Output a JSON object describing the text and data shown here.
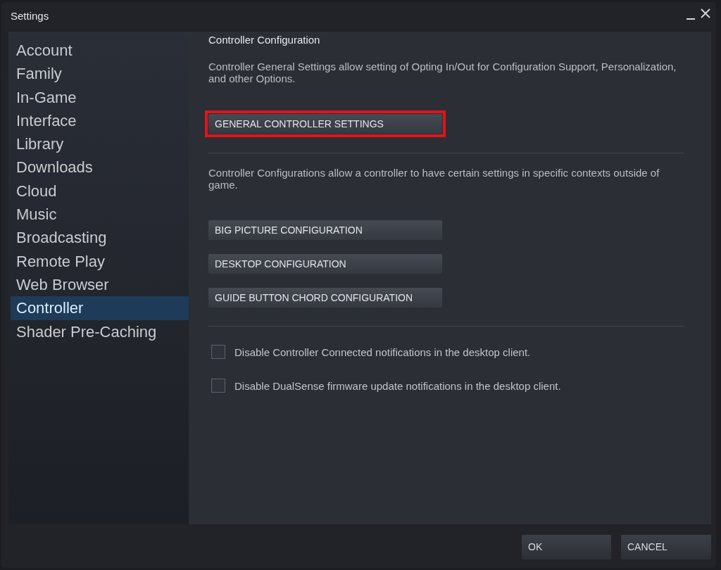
{
  "window": {
    "title": "Settings"
  },
  "sidebar": {
    "items": [
      {
        "label": "Account",
        "selected": false
      },
      {
        "label": "Family",
        "selected": false
      },
      {
        "label": "In-Game",
        "selected": false
      },
      {
        "label": "Interface",
        "selected": false
      },
      {
        "label": "Library",
        "selected": false
      },
      {
        "label": "Downloads",
        "selected": false
      },
      {
        "label": "Cloud",
        "selected": false
      },
      {
        "label": "Music",
        "selected": false
      },
      {
        "label": "Broadcasting",
        "selected": false
      },
      {
        "label": "Remote Play",
        "selected": false
      },
      {
        "label": "Web Browser",
        "selected": false
      },
      {
        "label": "Controller",
        "selected": true
      },
      {
        "label": "Shader Pre-Caching",
        "selected": false
      }
    ]
  },
  "content": {
    "heading": "Controller Configuration",
    "sections": [
      {
        "description": "Controller General Settings allow setting of Opting In/Out for Configuration Support, Personalization, and other Options.",
        "buttons": [
          {
            "label": "GENERAL CONTROLLER SETTINGS",
            "highlighted": true
          }
        ]
      },
      {
        "description": "Controller Configurations allow a controller to have certain settings in specific contexts outside of game.",
        "buttons": [
          {
            "label": "BIG PICTURE CONFIGURATION",
            "highlighted": false
          },
          {
            "label": "DESKTOP CONFIGURATION",
            "highlighted": false
          },
          {
            "label": "GUIDE BUTTON CHORD CONFIGURATION",
            "highlighted": false
          }
        ]
      }
    ],
    "options": [
      {
        "label": "Disable Controller Connected notifications in the desktop client.",
        "checked": false
      },
      {
        "label": "Disable DualSense firmware update notifications in the desktop client.",
        "checked": false
      }
    ]
  },
  "footer": {
    "buttons": [
      "OK",
      "CANCEL"
    ]
  }
}
